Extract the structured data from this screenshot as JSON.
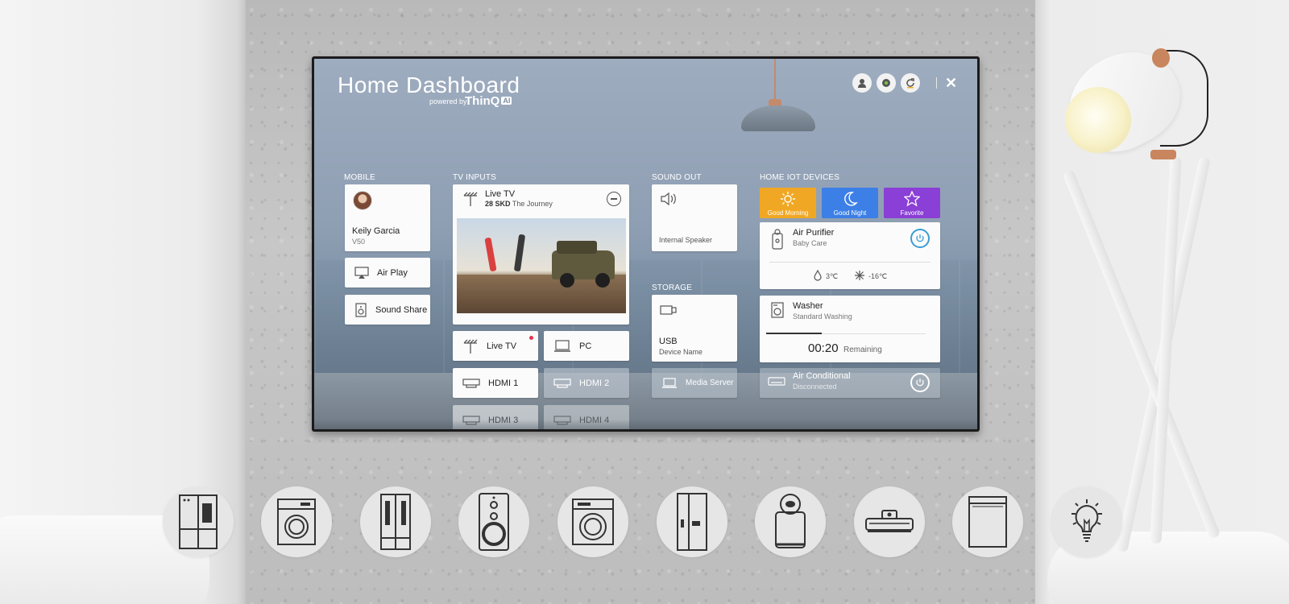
{
  "dashboard": {
    "title": "Home Dashboard",
    "powered_by": "powered by",
    "logo": "ThinQ",
    "logo_badge": "AI",
    "close_symbol": "✕"
  },
  "top_icons": [
    "account-icon",
    "settings-icon",
    "refresh-icon"
  ],
  "sections": {
    "mobile": "MOBILE",
    "tv_inputs": "TV INPUTS",
    "sound_out": "SOUND OUT",
    "storage": "STORAGE",
    "home_iot": "HOME IOT DEVICES"
  },
  "mobile": {
    "user_name": "Keily Garcia",
    "device": "V50",
    "air_play": "Air Play",
    "sound_share": "Sound Share"
  },
  "tv_inputs": {
    "live": {
      "title": "Live TV",
      "channel": "28 SKD",
      "program": "The Journey"
    },
    "inputs": [
      {
        "label": "Live TV",
        "icon": "antenna-icon",
        "active_dot": true
      },
      {
        "label": "PC",
        "icon": "laptop-icon"
      },
      {
        "label": "HDMI 1",
        "icon": "hdmi-icon"
      },
      {
        "label": "HDMI 2",
        "icon": "hdmi-icon"
      },
      {
        "label": "HDMI 3",
        "icon": "hdmi-icon"
      },
      {
        "label": "HDMI 4",
        "icon": "hdmi-icon"
      }
    ]
  },
  "sound_out": {
    "label": "Internal Speaker"
  },
  "storage": {
    "usb_title": "USB",
    "usb_sub": "Device Name",
    "media_server": "Media Server"
  },
  "iot": {
    "scenes": [
      {
        "label": "Good Morning",
        "color": "#f0a824",
        "icon": "sun-icon"
      },
      {
        "label": "Good Night",
        "color": "#3c7fe6",
        "icon": "moon-icon"
      },
      {
        "label": "Favorite",
        "color": "#8a3fd6",
        "icon": "star-icon"
      }
    ],
    "air_purifier": {
      "title": "Air Purifier",
      "sub": "Baby Care",
      "humidity": "3℃",
      "temp": "-16℃"
    },
    "washer": {
      "title": "Washer",
      "sub": "Standard Washing",
      "time": "00:20",
      "remaining": "Remaining",
      "progress": 0.35
    },
    "air_conditional": {
      "title": "Air Conditional",
      "sub": "Disconnected"
    }
  },
  "appliances": [
    "refrigerator-icon",
    "dryer-icon",
    "wine-cellar-icon",
    "speaker-icon",
    "washing-machine-icon",
    "fridge-icon",
    "air-purifier-icon",
    "robot-vacuum-icon",
    "dishwasher-icon",
    "light-bulb-icon"
  ],
  "colors": {
    "accent_blue": "#3a9cd5",
    "live_dot": "#e6334b"
  }
}
